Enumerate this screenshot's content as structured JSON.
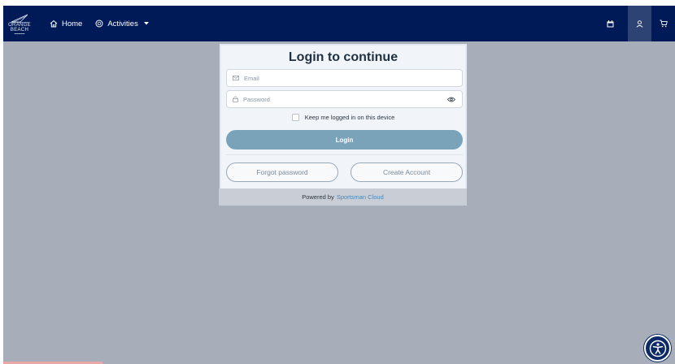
{
  "navbar": {
    "logo_line1": "ORANGE",
    "logo_line2": "BEACH",
    "home_label": "Home",
    "activities_label": "Activities",
    "icons": [
      "calendar-icon",
      "user-icon",
      "cart-icon"
    ]
  },
  "login": {
    "title": "Login to continue",
    "email_placeholder": "Email",
    "password_placeholder": "Password",
    "keep_logged_in_label": "Keep me logged in on this device",
    "login_button": "Login",
    "forgot_password_button": "Forgot password",
    "create_account_button": "Create Account"
  },
  "footer": {
    "powered_by": "Powered by",
    "provider": "Sportsman Cloud"
  },
  "colors": {
    "navbar_bg": "#001a57",
    "page_bg": "#a7adb9",
    "login_button": "#7aa2b8",
    "link": "#4a86b5"
  }
}
